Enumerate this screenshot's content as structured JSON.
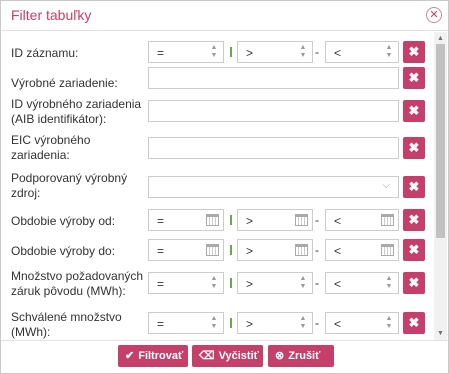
{
  "dialog": {
    "title": "Filter tabuľky",
    "close_icon": "close-circle-icon"
  },
  "rows": [
    {
      "label": "ID záznamu:",
      "type": "range",
      "operator": "=",
      "from_operator": ">",
      "to_operator": "<",
      "dash": "-",
      "input_icon": "spinner-icon"
    },
    {
      "label": "Výrobné zariadenie:",
      "type": "text",
      "value": ""
    },
    {
      "label": "ID výrobného zariadenia (AIB identifikátor):",
      "type": "text",
      "value": ""
    },
    {
      "label": "EIC výrobného zariadenia:",
      "type": "text",
      "value": ""
    },
    {
      "label": "Podporovaný výrobný zdroj:",
      "type": "select",
      "value": ""
    },
    {
      "label": "Obdobie výroby od:",
      "type": "range",
      "operator": "=",
      "from_operator": ">",
      "to_operator": "<",
      "dash": "-",
      "input_icon": "calendar-icon"
    },
    {
      "label": "Obdobie výroby do:",
      "type": "range",
      "operator": "=",
      "from_operator": ">",
      "to_operator": "<",
      "dash": "-",
      "input_icon": "calendar-icon"
    },
    {
      "label": "Množstvo požadovaných záruk pôvodu (MWh):",
      "type": "range",
      "operator": "=",
      "from_operator": ">",
      "to_operator": "<",
      "dash": "-",
      "input_icon": "spinner-icon"
    },
    {
      "label": "Schválené množstvo (MWh):",
      "type": "range",
      "operator": "=",
      "from_operator": ">",
      "to_operator": "<",
      "dash": "-",
      "input_icon": "spinner-icon"
    }
  ],
  "clear_icon": "x-icon",
  "footer": {
    "filter_label": "Filtrovať",
    "clear_label": "Vyčistiť",
    "cancel_label": "Zrušiť"
  },
  "colors": {
    "accent": "#c4406a",
    "separator": "#6aa84f"
  }
}
